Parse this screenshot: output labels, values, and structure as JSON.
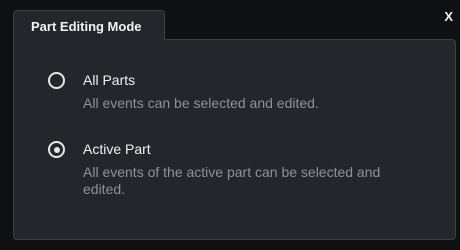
{
  "dialog": {
    "tab_title": "Part Editing Mode",
    "close_label": "X",
    "options": [
      {
        "label": "All Parts",
        "description": "All events can be selected and edited.",
        "selected": false
      },
      {
        "label": "Active Part",
        "description": "All events of the active part can be selected and edited.",
        "selected": true
      }
    ]
  },
  "colors": {
    "background": "#0e1012",
    "panel": "#23272b",
    "border": "#3b4046",
    "text": "#f0f0f0",
    "muted_text": "#8e9297"
  }
}
